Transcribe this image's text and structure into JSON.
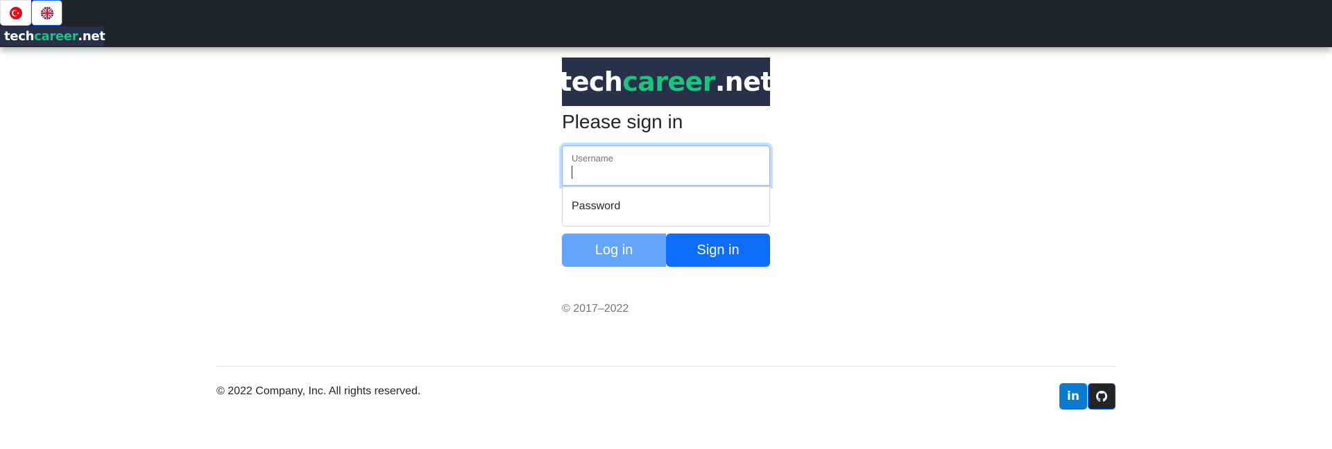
{
  "nav": {
    "languages": [
      {
        "code": "tr",
        "icon": "turkey-flag-icon"
      },
      {
        "code": "en",
        "icon": "uk-flag-icon"
      }
    ],
    "brand": {
      "part1": "tech",
      "part2": "career",
      "part3": ".net"
    }
  },
  "form": {
    "logo": {
      "part1": "tech",
      "part2": "career",
      "part3": ".net"
    },
    "heading": "Please sign in",
    "username_label": "Username",
    "password_placeholder": "Password",
    "login_label": "Log in",
    "signin_label": "Sign in",
    "copyright": "© 2017–2022"
  },
  "footer": {
    "text": "© 2022 Company, Inc. All rights reserved.",
    "linkedin_label": "in",
    "icons": [
      "linkedin-icon",
      "github-icon"
    ]
  },
  "colors": {
    "navbar": "#212529",
    "brand_bg": "#283149",
    "brand_green": "#1bc47d",
    "primary": "#0d6efd",
    "primary_light": "#63a4ff",
    "linkedin": "#0a7bcf"
  }
}
